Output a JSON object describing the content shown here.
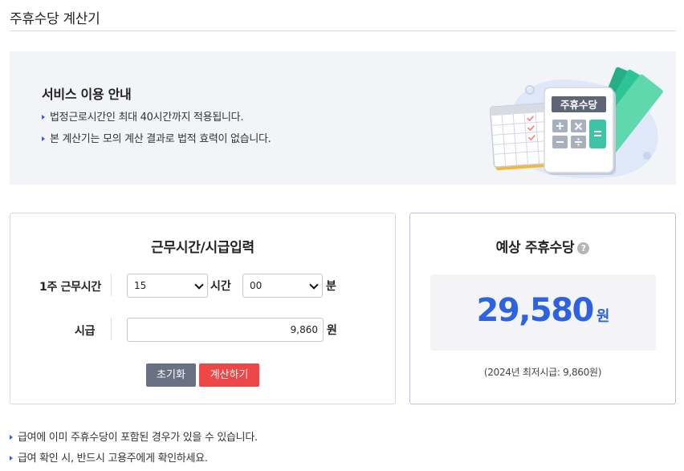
{
  "page": {
    "title": "주휴수당 계산기"
  },
  "guide": {
    "heading": "서비스 이용 안내",
    "items": [
      "법정근로시간인 최대 40시간까지 적용됩니다.",
      "본 계산기는 모의 계산 결과로 법적 효력이 없습니다."
    ],
    "illustration": {
      "calculator_label": "주휴수당",
      "icons": [
        "calendar-icon",
        "calculator-icon",
        "money-icon"
      ]
    }
  },
  "input_card": {
    "title": "근무시간/시급입력",
    "weekly_hours_label": "1주 근무시간",
    "hours_value": "15",
    "hours_unit": "시간",
    "minutes_value": "00",
    "minutes_unit": "분",
    "wage_label": "시급",
    "wage_value": "9,860",
    "wage_unit": "원",
    "reset_label": "초기화",
    "calculate_label": "계산하기"
  },
  "result_card": {
    "title": "예상 주휴수당",
    "help_symbol": "?",
    "amount": "29,580",
    "unit": "원",
    "min_wage_note": "(2024년 최저시급: 9,860원)"
  },
  "notes": [
    "급여에 이미 주휴수당이 포함된 경우가 있을 수 있습니다.",
    "급여 확인 시, 반드시 고용주에게 확인하세요."
  ],
  "colors": {
    "accent_blue": "#2d63e0",
    "calc_button": "#ee4747",
    "reset_button": "#6b7185",
    "guide_bg": "#f2f4f8"
  }
}
